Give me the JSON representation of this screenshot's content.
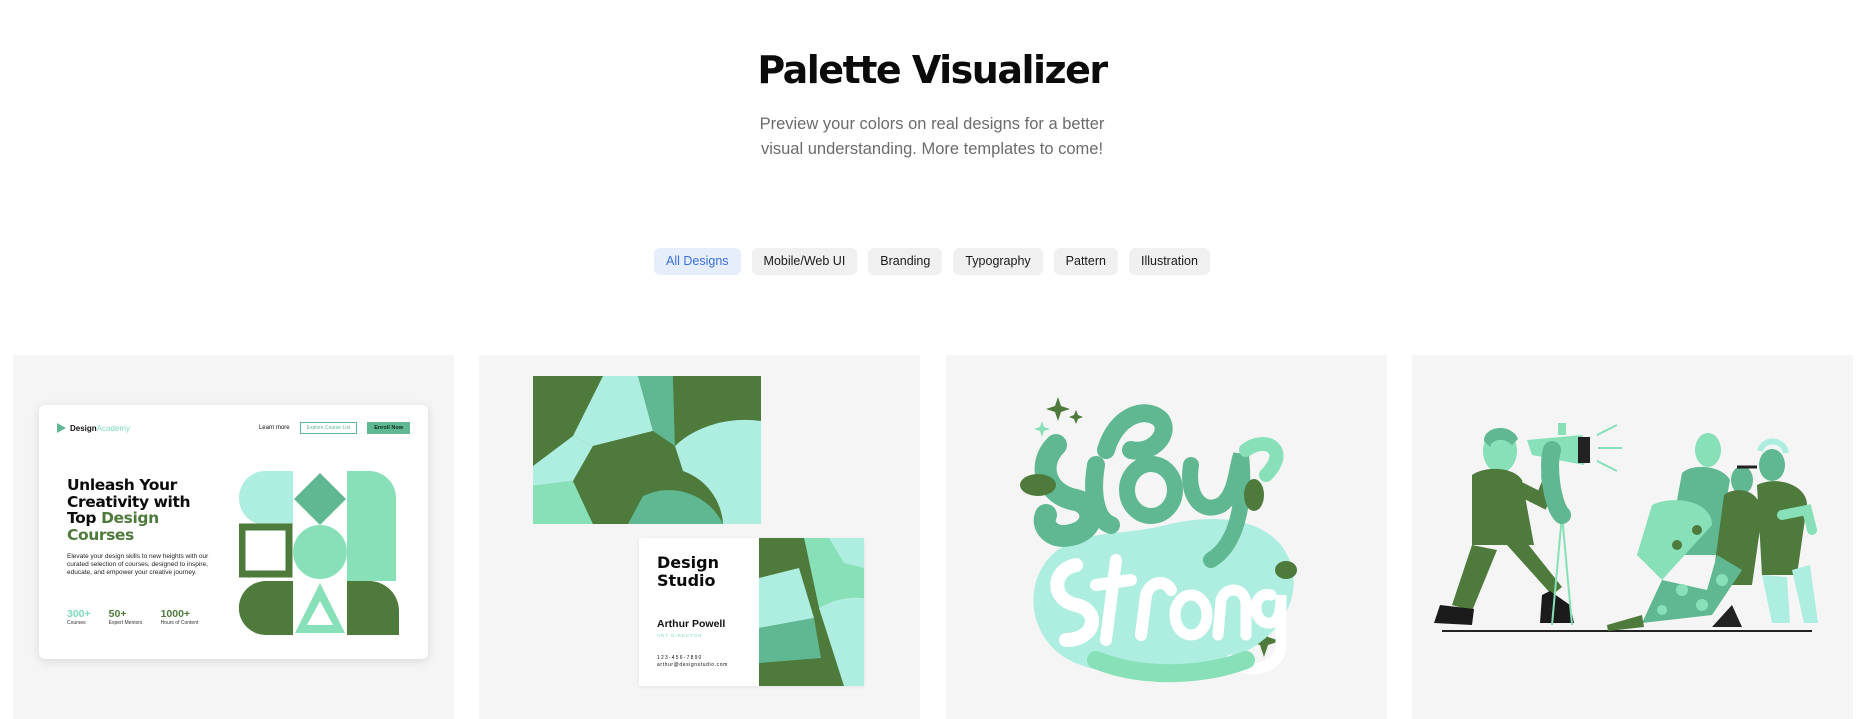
{
  "header": {
    "title": "Palette Visualizer",
    "subtitle": "Preview your colors on real designs for a better visual understanding. More templates to come!"
  },
  "filters": [
    {
      "label": "All Designs",
      "active": true
    },
    {
      "label": "Mobile/Web UI",
      "active": false
    },
    {
      "label": "Branding",
      "active": false
    },
    {
      "label": "Typography",
      "active": false
    },
    {
      "label": "Pattern",
      "active": false
    },
    {
      "label": "Illustration",
      "active": false
    }
  ],
  "colors": {
    "mint_light": "#aeeee0",
    "mint": "#87e0b8",
    "green_mid": "#5fb892",
    "green_dark": "#4e7a3c",
    "card_bg": "#f5f5f5",
    "accent_blue": "#3b6fe0"
  },
  "web_mockup": {
    "logo_word": "Design",
    "logo_accent": "Academy",
    "nav_learn": "Learn more",
    "nav_outline_button": "Explore Course List",
    "nav_solid_button": "Enroll Now",
    "headline_line1": "Unleash Your",
    "headline_line2": "Creativity with",
    "headline_line3_start": "Top ",
    "headline_line3_highlight": "Design",
    "headline_line4": "Courses",
    "body": "Elevate your design skills to new heights with our curated selection of courses, designed to inspire, educate, and empower your creative journey.",
    "stats": [
      {
        "value": "300+",
        "label": "Courses"
      },
      {
        "value": "50+",
        "label": "Expert Mentors"
      },
      {
        "value": "1000+",
        "label": "Hours of Content"
      }
    ]
  },
  "business_card": {
    "company_line1": "Design",
    "company_line2": "Studio",
    "person": "Arthur Powell",
    "role": "ART DIRECTOR",
    "phone": "123-456-7890",
    "email": "arthur@designstudio.com"
  },
  "typography_art": {
    "icon": "stay-strong-lettering-icon"
  },
  "illustration_art": {
    "icon": "people-illustration-icon"
  }
}
